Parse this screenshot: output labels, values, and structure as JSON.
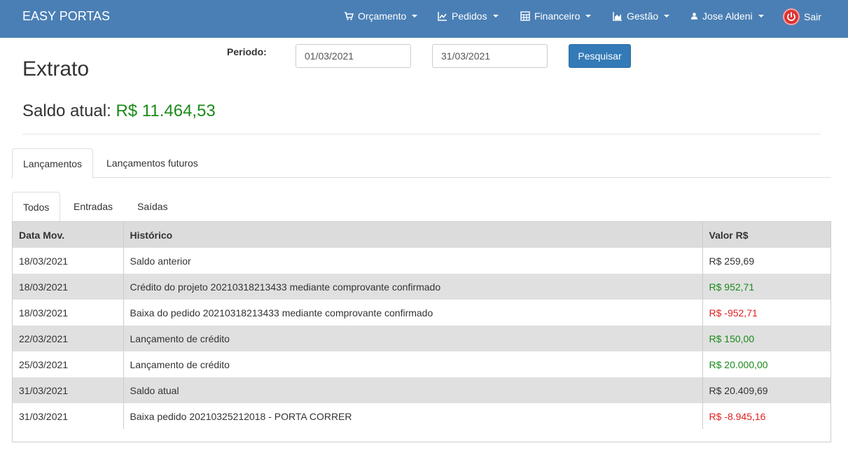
{
  "navbar": {
    "brand": "EASY PORTAS",
    "items": [
      {
        "label": "Orçamento",
        "icon": "cart-icon"
      },
      {
        "label": "Pedidos",
        "icon": "line-chart-icon"
      },
      {
        "label": "Financeiro",
        "icon": "calculator-icon"
      },
      {
        "label": "Gestão",
        "icon": "area-chart-icon"
      },
      {
        "label": "Jose Aldeni",
        "icon": "user-icon"
      }
    ],
    "logout": "Sair"
  },
  "filter": {
    "label": "Periodo:",
    "start_date": "01/03/2021",
    "end_date": "31/03/2021",
    "search_button": "Pesquisar"
  },
  "page": {
    "title": "Extrato",
    "balance_label": "Saldo atual:",
    "balance_value": "R$ 11.464,53"
  },
  "tabs_main": [
    "Lançamentos",
    "Lançamentos futuros"
  ],
  "tabs_filter": [
    "Todos",
    "Entradas",
    "Saídas"
  ],
  "table": {
    "headers": [
      "Data Mov.",
      "Histórico",
      "Valor R$"
    ],
    "rows": [
      {
        "date": "18/03/2021",
        "history": "Saldo anterior",
        "value": "R$ 259,69",
        "type": "neutral"
      },
      {
        "date": "18/03/2021",
        "history": "Crédito do projeto 20210318213433 mediante comprovante confirmado",
        "value": "R$ 952,71",
        "type": "green"
      },
      {
        "date": "18/03/2021",
        "history": "Baixa do pedido 20210318213433 mediante comprovante confirmado",
        "value": "R$ -952,71",
        "type": "red"
      },
      {
        "date": "22/03/2021",
        "history": "Lançamento de crédito",
        "value": "R$ 150,00",
        "type": "green"
      },
      {
        "date": "25/03/2021",
        "history": "Lançamento de crédito",
        "value": "R$ 20.000,00",
        "type": "green"
      },
      {
        "date": "31/03/2021",
        "history": "Saldo atual",
        "value": "R$ 20.409,69",
        "type": "neutral"
      },
      {
        "date": "31/03/2021",
        "history": "Baixa pedido 20210325212018 - PORTA CORRER",
        "value": "R$ -8.945,16",
        "type": "red"
      }
    ]
  },
  "colors": {
    "navbar": "#4a7fb5",
    "primary": "#337ab7",
    "positive": "#1a8a1a",
    "negative": "#e02020"
  }
}
